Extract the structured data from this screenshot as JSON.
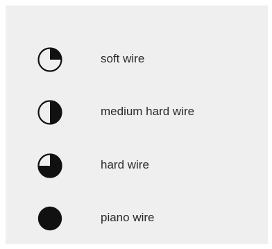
{
  "legend": {
    "items": [
      {
        "icon": "quarter-filled-circle-icon",
        "fill_fraction": 0.25,
        "label": "soft wire"
      },
      {
        "icon": "half-filled-circle-icon",
        "fill_fraction": 0.5,
        "label": "medium hard wire"
      },
      {
        "icon": "three-quarter-filled-circle-icon",
        "fill_fraction": 0.75,
        "label": "hard wire"
      },
      {
        "icon": "full-filled-circle-icon",
        "fill_fraction": 1.0,
        "label": "piano wire"
      }
    ]
  },
  "colors": {
    "panel_background": "#efeff0",
    "icon_fill": "#111111",
    "icon_stroke": "#111111",
    "text": "#2a2a2a"
  }
}
